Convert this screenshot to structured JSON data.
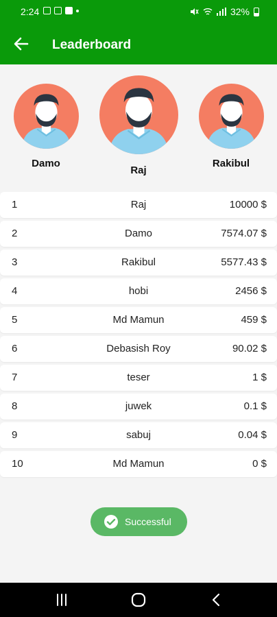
{
  "status_bar": {
    "time": "2:24",
    "battery": "32%"
  },
  "app_bar": {
    "title": "Leaderboard"
  },
  "podium": {
    "second": {
      "name": "Damo"
    },
    "first": {
      "name": "Raj"
    },
    "third": {
      "name": "Rakibul"
    }
  },
  "leaderboard": [
    {
      "rank": "1",
      "name": "Raj",
      "amount": "10000 $"
    },
    {
      "rank": "2",
      "name": "Damo",
      "amount": "7574.07 $"
    },
    {
      "rank": "3",
      "name": "Rakibul",
      "amount": "5577.43 $"
    },
    {
      "rank": "4",
      "name": "hobi",
      "amount": "2456 $"
    },
    {
      "rank": "5",
      "name": "Md Mamun",
      "amount": "459 $"
    },
    {
      "rank": "6",
      "name": "Debasish Roy",
      "amount": "90.02 $"
    },
    {
      "rank": "7",
      "name": "teser",
      "amount": "1 $"
    },
    {
      "rank": "8",
      "name": "juwek",
      "amount": "0.1 $"
    },
    {
      "rank": "9",
      "name": "sabuj",
      "amount": "0.04 $"
    },
    {
      "rank": "10",
      "name": "Md Mamun",
      "amount": "0 $"
    }
  ],
  "toast": {
    "message": "Successful"
  },
  "colors": {
    "primary": "#0a9a0a",
    "avatar_bg": "#f47d62",
    "toast": "#5ab865"
  },
  "icons": {
    "back": "arrow-left-icon",
    "toast": "check-circle-icon",
    "nav": [
      "recents-icon",
      "home-icon",
      "back-nav-icon"
    ]
  }
}
